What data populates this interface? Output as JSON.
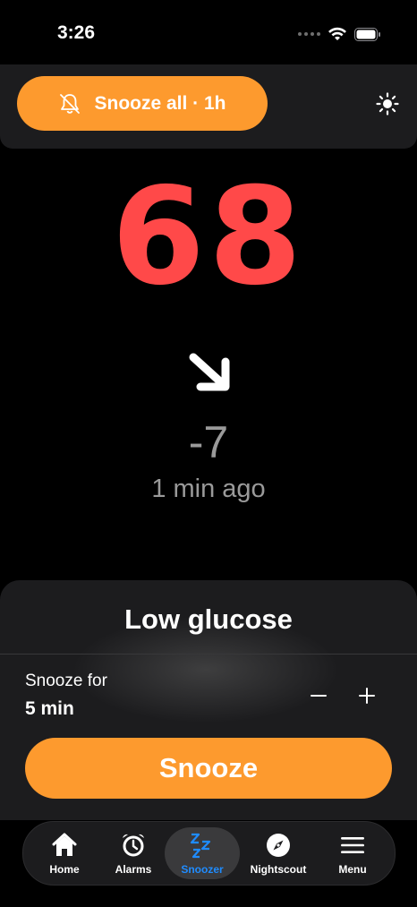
{
  "status_bar": {
    "time": "3:26"
  },
  "top_panel": {
    "snooze_all_label": "Snooze all · 1h"
  },
  "reading": {
    "value": "68",
    "delta": "-7",
    "updated": "1 min ago"
  },
  "alarm": {
    "title": "Low glucose",
    "snooze_for_label": "Snooze for",
    "snooze_for_value": "5 min",
    "snooze_button": "Snooze"
  },
  "tabs": [
    {
      "label": "Home",
      "icon": "house-icon"
    },
    {
      "label": "Alarms",
      "icon": "alarm-clock-icon"
    },
    {
      "label": "Snoozer",
      "icon": "zzz-icon",
      "active": true
    },
    {
      "label": "Nightscout",
      "icon": "compass-icon"
    },
    {
      "label": "Menu",
      "icon": "menu-icon"
    }
  ],
  "colors": {
    "accent_orange": "#fd9a2e",
    "glucose_low_red": "#ff4949",
    "active_tab_blue": "#1f8cff",
    "panel_bg": "#1c1c1e"
  }
}
